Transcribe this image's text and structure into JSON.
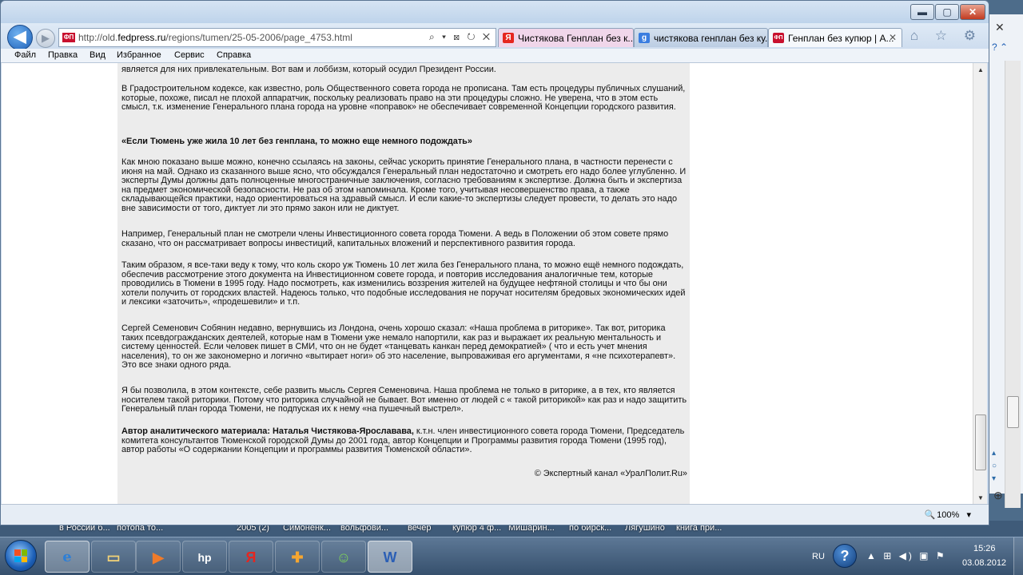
{
  "browser": {
    "url_prefix": "http://old.",
    "url_domain": "fedpress.ru",
    "url_path": "/regions/tumen/25-05-2006/page_4753.html",
    "addr_tools": "⌕ ▾ ⊠ ↻ ✕",
    "favicon_text": "ФП",
    "back_glyph": "◀",
    "forward_glyph": "▶",
    "tabs": [
      {
        "label": "Чистякова Генплан без к...",
        "icon": "yandex-icon",
        "icon_text": "Я",
        "icon_color": "#e52620",
        "close": "",
        "bg": "#f3d3ea"
      },
      {
        "label": "чистякова генплан без ку...",
        "icon": "google-icon",
        "icon_text": "g",
        "icon_color": "#3a7de0",
        "close": "",
        "bg": "#bccde3"
      },
      {
        "label": "Генплан без купюр | А...",
        "icon": "fedpress-icon",
        "icon_text": "ФП",
        "icon_color": "#c8102e",
        "close": "✕",
        "bg": "#f5f8fc"
      }
    ],
    "right_icons": "⌂ ☆ ⚙",
    "window_controls": {
      "minimize": "▬",
      "maximize": "▢",
      "close": "✕"
    }
  },
  "menu": [
    "Файл",
    "Правка",
    "Вид",
    "Избранное",
    "Сервис",
    "Справка"
  ],
  "article": {
    "p0": "является для них привлекательным. Вот вам и лоббизм, который осудил Президент России.",
    "p1": "В Градостроительном кодексе, как известно, роль Общественного совета города не прописана. Там есть процедуры публичных слушаний, которые, похоже, писал не плохой аппаратчик, поскольку реализовать право на эти процедуры сложно. Не уверена, что в этом есть смысл, т.к. изменение Генерального плана города на уровне «поправок» не обеспечивает современной Концепции городского развития.",
    "heading": "«Если Тюмень уже жила 10 лет без генплана, то можно еще немного подождать»",
    "p2": "Как мною показано выше можно, конечно ссылаясь на законы, сейчас ускорить принятие Генерального плана, в частности перенести с июня на май. Однако из сказанного выше ясно, что обсуждался Генеральный план недостаточно и смотреть его надо более углубленно. И эксперты Думы должны дать полноценные многостраничные заключения, согласно требованиям к экспертизе. Должна быть и экспертиза на предмет экономической безопасности. Не раз об этом напоминала. Кроме того, учитывая несовершенство права, а также складывающейся практики, надо ориентироваться на здравый смысл. И если какие-то экспертизы следует провести, то делать это надо вне зависимости от того, диктует ли это прямо закон или не диктует.",
    "p3": "Например, Генеральный план не смотрели члены Инвестиционного совета города Тюмени. А ведь в Положении об этом совете прямо сказано, что он рассматривает вопросы инвестиций, капитальных вложений и перспективного развития города.",
    "p4": "Таким образом, я все-таки веду к тому, что коль скоро уж Тюмень 10 лет жила без Генерального плана, то можно ещё немного подождать, обеспечив рассмотрение этого документа на Инвестиционном совете города, и повторив исследования аналогичные тем, которые проводились в Тюмени в 1995 году. Надо посмотреть, как изменились воззрения жителей на будущее нефтяной столицы и что бы они хотели получить от городских властей. Надеюсь только, что подобные исследования не поручат носителям бредовых экономических идей и лексики «заточить», «продешевили» и т.п.",
    "p5": "Сергей Семенович Собянин недавно, вернувшись из Лондона, очень хорошо сказал: «Наша проблема в риторике». Так вот, риторика таких псевдогражданских деятелей, которые нам в Тюмени уже немало напортили, как раз и выражает их реальную ментальность и систему ценностей. Если человек пишет в СМИ, что он не будет «танцевать канкан перед демократией» ( что и есть учет мнения населения), то он же закономерно и логично «вытирает ноги» об это население, выпроваживая его аргументами, я «не психотерапевт». Это все знаки одного ряда.",
    "p6": "Я бы позволила, в этом контексте, себе развить мысль Сергея Семеновича. Наша проблема не только в риторике, а в тех, кто является носителем такой риторики. Потому что риторика случайной не бывает. Вот именно от людей с « такой риторикой» как раз и надо защитить Генеральный план города Тюмени, не подпуская их к нему «на пушечный выстрел».",
    "author_bold": "Автор аналитического материала: Наталья Чистякова-Ярославава,",
    "author_rest": " к.т.н. член инвестиционного совета города Тюмени, Председатель комитета консультантов Тюменской городской Думы до 2001 года, автор Концепции и Программы развития города Тюмени (1995 год), автор работы «О содержании Концепции и программы развития Тюменской области».",
    "copyright": "© Экспертный канал «УралПолит.Ru»"
  },
  "status": {
    "zoom": "100%",
    "zoom_icon": "zoom-icon",
    "zoom_glyph": "🔍",
    "zoom_arrow": "▾"
  },
  "desktop_labels": [
    "в России б...",
    "потопа то...",
    "2005 (2)",
    "Симоненк...",
    "вольфови...",
    "вечер",
    "купюр 4 ф...",
    "Мишарин...",
    "по бирск...",
    "Лягушино",
    "книга при..."
  ],
  "taskbar": {
    "apps": [
      {
        "name": "ie-taskbar-button",
        "icon": "ie-icon",
        "glyph": "e",
        "active": true
      },
      {
        "name": "explorer-taskbar-button",
        "icon": "folder-icon",
        "glyph": "▭",
        "active": false
      },
      {
        "name": "media-taskbar-button",
        "icon": "media-player-icon",
        "glyph": "▶",
        "active": false
      },
      {
        "name": "hp-taskbar-button",
        "icon": "hp-icon",
        "glyph": "hp",
        "active": false
      },
      {
        "name": "yandex-taskbar-button",
        "icon": "yandex-icon",
        "glyph": "Я",
        "active": false
      },
      {
        "name": "app-taskbar-button",
        "icon": "package-icon",
        "glyph": "✚",
        "active": false
      },
      {
        "name": "messenger-taskbar-button",
        "icon": "people-icon",
        "glyph": "☺",
        "active": false
      },
      {
        "name": "word-taskbar-button",
        "icon": "word-icon",
        "glyph": "W",
        "active": true
      }
    ],
    "lang": "RU",
    "help_glyph": "?",
    "tray_icons": "▲ ⊞ ◀) ▣ ⚑",
    "time": "15:26",
    "date": "03.08.2012"
  },
  "bg_window": {
    "close": "✕",
    "help": "? ⌃",
    "plus": "⊕",
    "nav_up": "▴",
    "nav_circle": "○",
    "nav_down": "▾"
  }
}
